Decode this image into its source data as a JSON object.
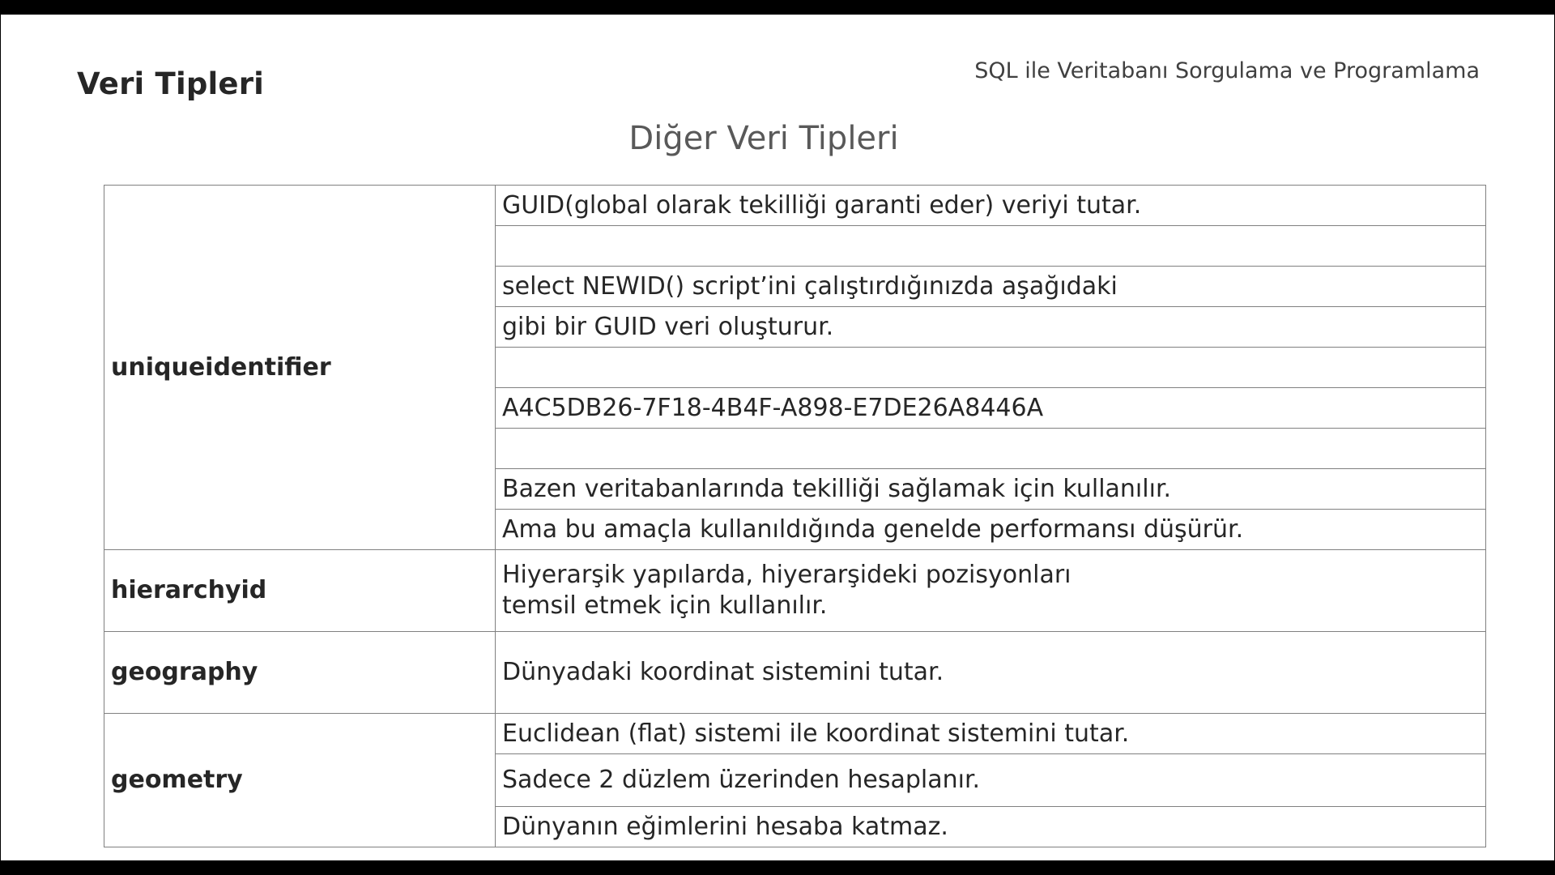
{
  "header": {
    "section_title": "Veri Tipleri",
    "course_title": "SQL ile Veritabanı Sorgulama ve Programlama",
    "slide_title": "Diğer Veri Tipleri"
  },
  "table": {
    "uniqueidentifier": {
      "type": "uniqueidentifier",
      "lines": [
        "GUID(global olarak tekilliği garanti eder) veriyi tutar.",
        "",
        "select NEWID() script’ini çalıştırdığınızda aşağıdaki",
        "gibi bir GUID veri oluşturur.",
        "",
        "A4C5DB26-7F18-4B4F-A898-E7DE26A8446A",
        "",
        "Bazen veritabanlarında tekilliği sağlamak için kullanılır.",
        "Ama bu amaçla kullanıldığında genelde performansı düşürür."
      ]
    },
    "hierarchyid": {
      "type": "hierarchyid",
      "line1": "Hiyerarşik yapılarda, hiyerarşideki pozisyonları",
      "line2": "temsil etmek için kullanılır."
    },
    "geography": {
      "type": "geography",
      "line": "Dünyadaki koordinat sistemini tutar."
    },
    "geometry": {
      "type": "geometry",
      "lines": [
        "Euclidean (flat) sistemi ile  koordinat sistemini tutar.",
        "Sadece 2 düzlem üzerinden hesaplanır.",
        "Dünyanın eğimlerini hesaba katmaz."
      ]
    }
  }
}
